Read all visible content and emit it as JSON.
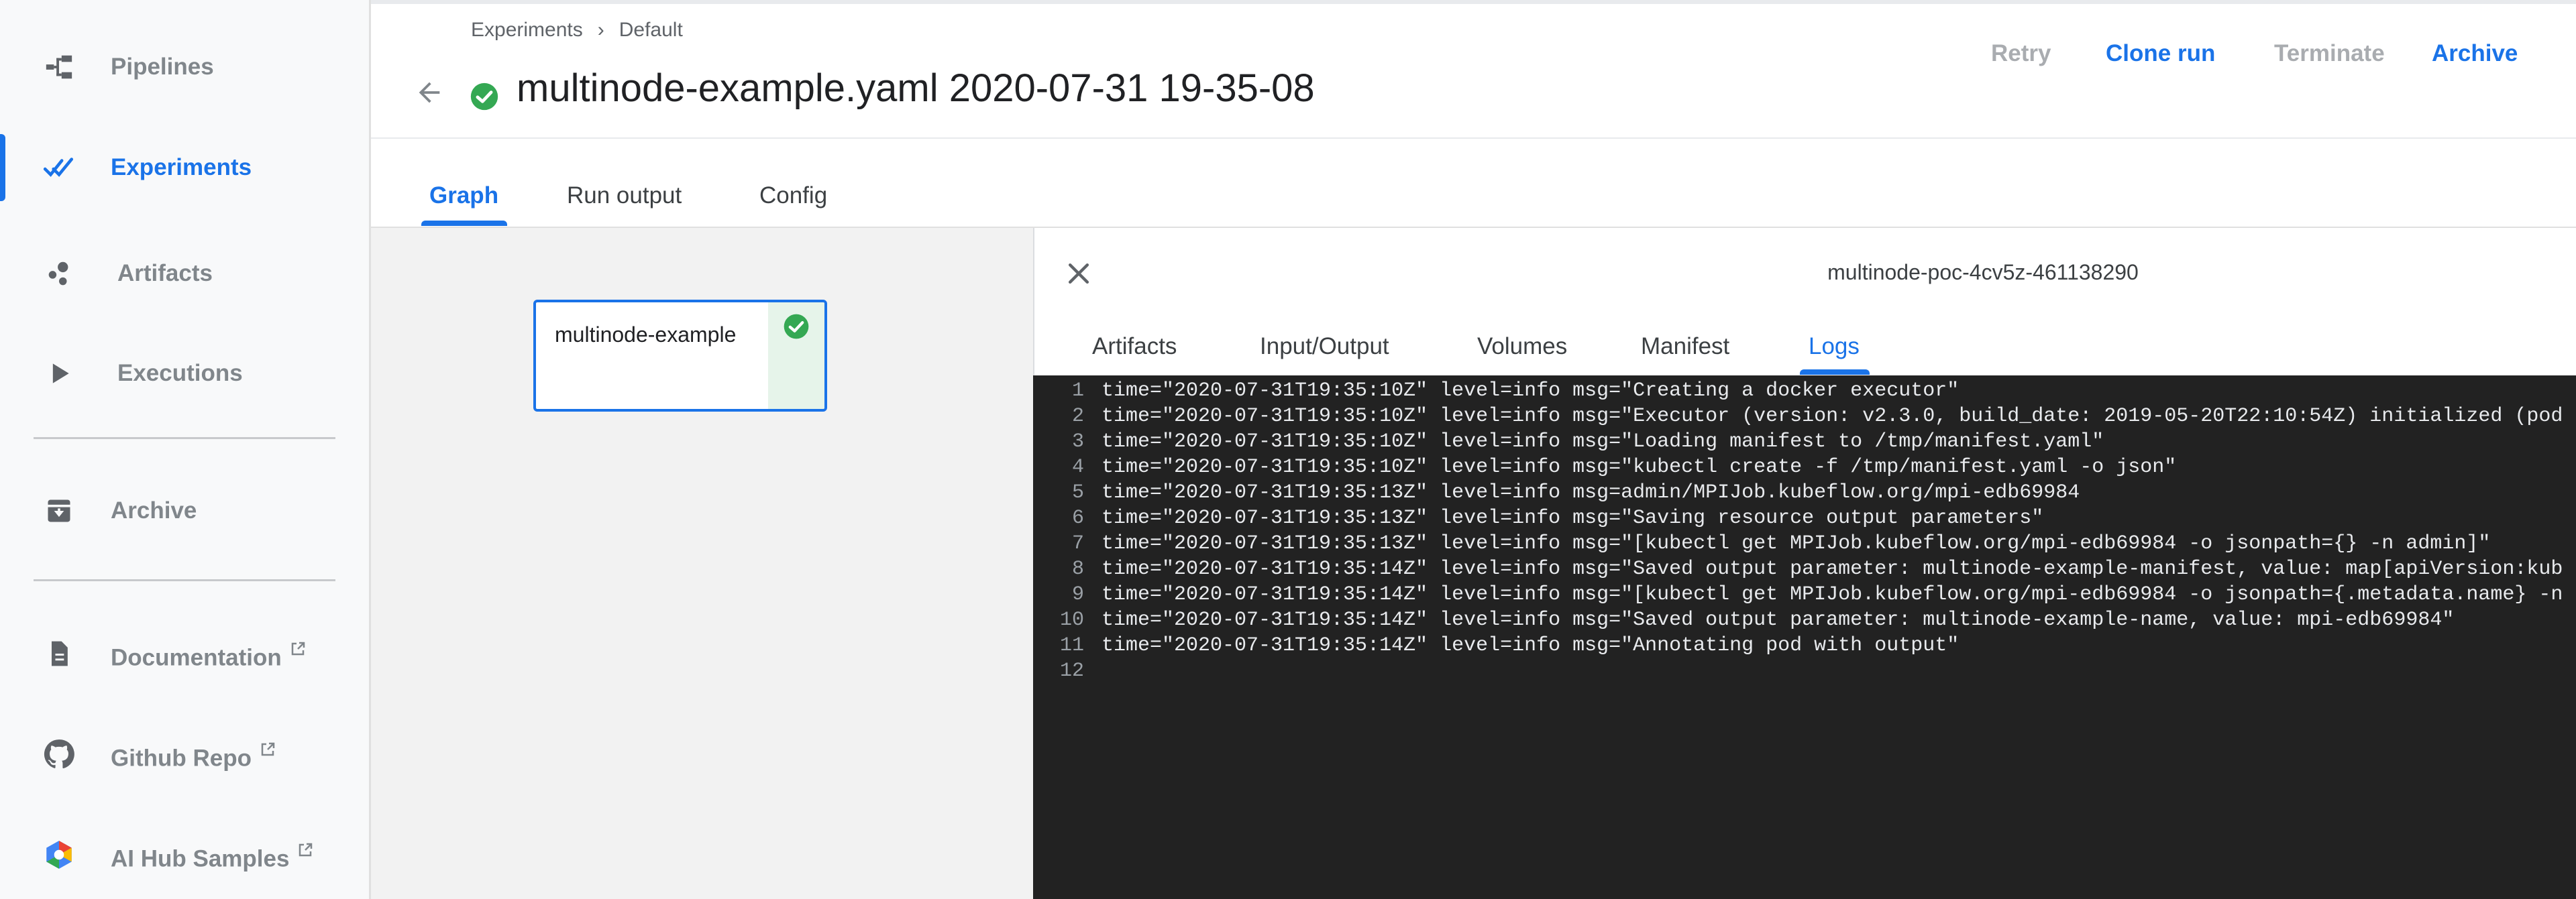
{
  "sidebar": {
    "items": [
      {
        "label": "Pipelines",
        "icon": "pipelines-icon"
      },
      {
        "label": "Experiments",
        "icon": "experiments-icon",
        "active": true
      },
      {
        "label": "Artifacts",
        "icon": "artifacts-icon"
      },
      {
        "label": "Executions",
        "icon": "executions-icon"
      },
      {
        "label": "Archive",
        "icon": "archive-icon"
      },
      {
        "label": "Documentation",
        "icon": "documentation-icon",
        "external": true
      },
      {
        "label": "Github Repo",
        "icon": "github-icon",
        "external": true
      },
      {
        "label": "AI Hub Samples",
        "icon": "ai-hub-icon",
        "external": true
      }
    ]
  },
  "header": {
    "breadcrumb": [
      "Experiments",
      "Default"
    ],
    "breadcrumb_separator": "›",
    "title": "multinode-example.yaml 2020-07-31 19-35-08",
    "status_icon": "success-check-icon",
    "actions": {
      "retry": "Retry",
      "clone_run": "Clone run",
      "terminate": "Terminate",
      "archive": "Archive"
    }
  },
  "tabs": {
    "graph": "Graph",
    "run_output": "Run output",
    "config": "Config",
    "active": "graph"
  },
  "graph": {
    "node_label": "multinode-example",
    "node_status": "succeeded"
  },
  "panel": {
    "title": "multinode-poc-4cv5z-461138290",
    "tabs": {
      "artifacts": "Artifacts",
      "input_output": "Input/Output",
      "volumes": "Volumes",
      "manifest": "Manifest",
      "logs": "Logs"
    },
    "active_tab": "logs",
    "logs": [
      {
        "n": "1",
        "text": "time=\"2020-07-31T19:35:10Z\" level=info msg=\"Creating a docker executor\""
      },
      {
        "n": "2",
        "text": "time=\"2020-07-31T19:35:10Z\" level=info msg=\"Executor (version: v2.3.0, build_date: 2019-05-20T22:10:54Z) initialized (pod"
      },
      {
        "n": "3",
        "text": "time=\"2020-07-31T19:35:10Z\" level=info msg=\"Loading manifest to /tmp/manifest.yaml\""
      },
      {
        "n": "4",
        "text": "time=\"2020-07-31T19:35:10Z\" level=info msg=\"kubectl create -f /tmp/manifest.yaml -o json\""
      },
      {
        "n": "5",
        "text": "time=\"2020-07-31T19:35:13Z\" level=info msg=admin/MPIJob.kubeflow.org/mpi-edb69984"
      },
      {
        "n": "6",
        "text": "time=\"2020-07-31T19:35:13Z\" level=info msg=\"Saving resource output parameters\""
      },
      {
        "n": "7",
        "text": "time=\"2020-07-31T19:35:13Z\" level=info msg=\"[kubectl get MPIJob.kubeflow.org/mpi-edb69984 -o jsonpath={} -n admin]\""
      },
      {
        "n": "8",
        "text": "time=\"2020-07-31T19:35:14Z\" level=info msg=\"Saved output parameter: multinode-example-manifest, value: map[apiVersion:kub"
      },
      {
        "n": "9",
        "text": "time=\"2020-07-31T19:35:14Z\" level=info msg=\"[kubectl get MPIJob.kubeflow.org/mpi-edb69984 -o jsonpath={.metadata.name} -n"
      },
      {
        "n": "10",
        "text": "time=\"2020-07-31T19:35:14Z\" level=info msg=\"Saved output parameter: multinode-example-name, value: mpi-edb69984\""
      },
      {
        "n": "11",
        "text": "time=\"2020-07-31T19:35:14Z\" level=info msg=\"Annotating pod with output\""
      },
      {
        "n": "12",
        "text": ""
      }
    ]
  },
  "colors": {
    "accent": "#1a73e8",
    "success": "#34a853",
    "log_background": "#222222"
  }
}
